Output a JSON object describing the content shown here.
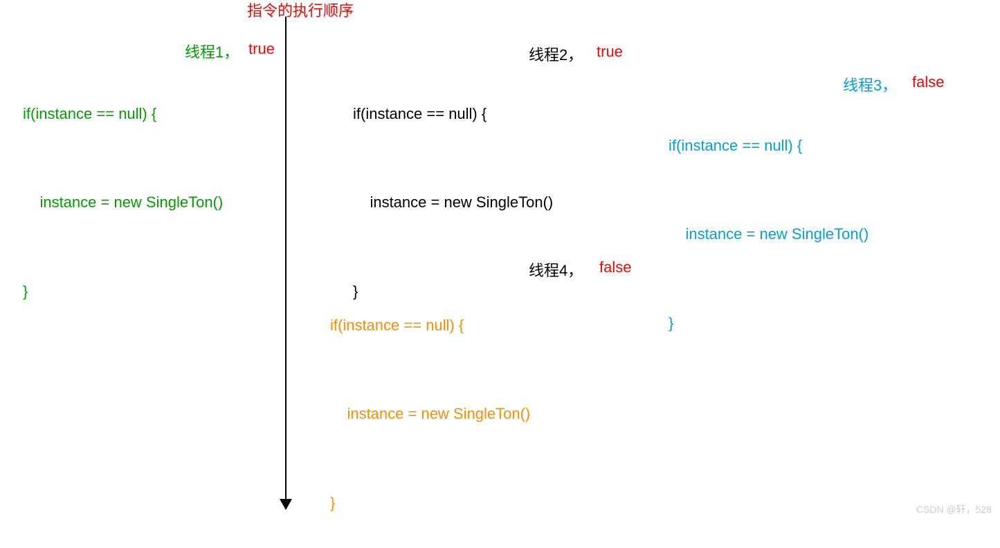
{
  "title": "指令的执行顺序",
  "code": {
    "line1": "if(instance == null) {",
    "line2": "    instance = new SingleTon()",
    "line3": "}"
  },
  "threads": {
    "t1": {
      "label": "线程1",
      "result": "true"
    },
    "t2": {
      "label": "线程2",
      "result": "true"
    },
    "t3": {
      "label": "线程3",
      "result": "false"
    },
    "t4": {
      "label": "线程4",
      "result": "false"
    }
  },
  "watermark": "CSDN @轩，528"
}
